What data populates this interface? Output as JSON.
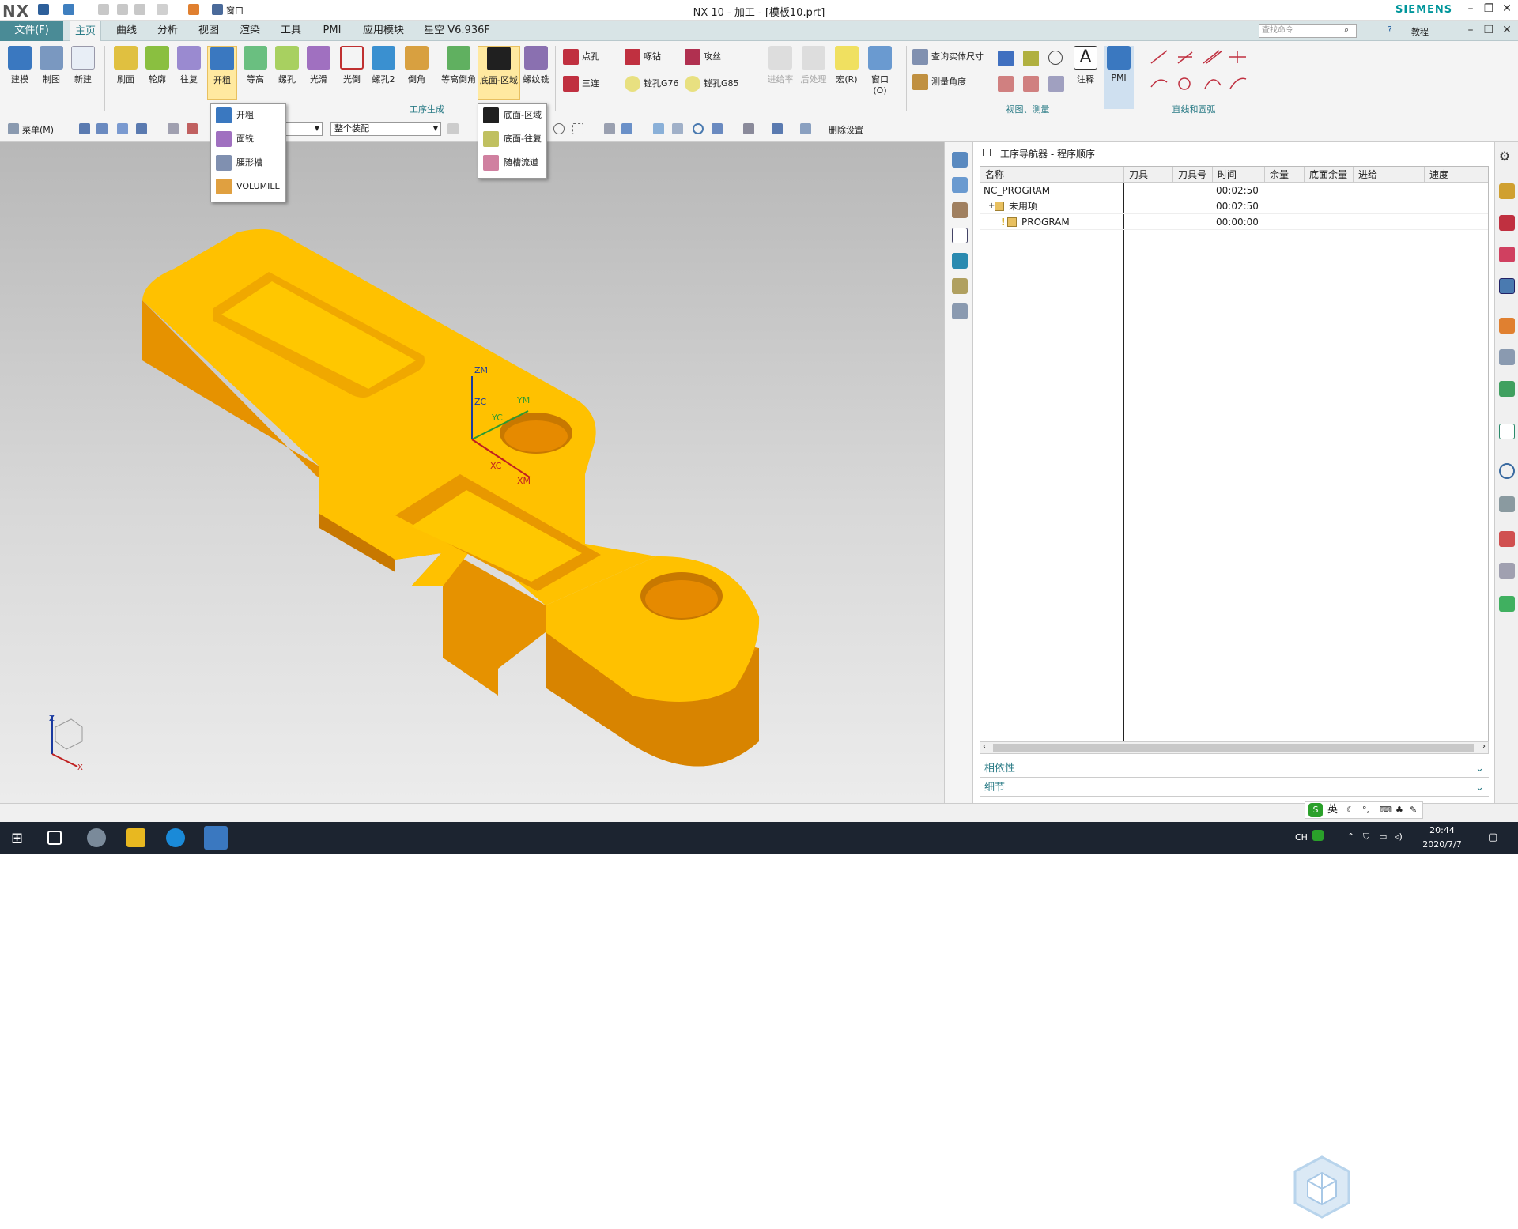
{
  "titlebar": {
    "app_logo": "NX",
    "title": "NX 10 - 加工 - [模板10.prt]",
    "window_menu": "窗口",
    "brand": "SIEMENS",
    "brand_color": "#00969b"
  },
  "menubar": {
    "file": "文件(F)",
    "tabs": [
      "主页",
      "曲线",
      "分析",
      "视图",
      "渲染",
      "工具",
      "PMI",
      "应用模块",
      "星空 V6.936F"
    ],
    "search_placeholder": "查找命令",
    "help_label": "教程"
  },
  "ribbon": {
    "left_buttons": [
      "建模",
      "制图",
      "新建"
    ],
    "ops_buttons": [
      "刷面",
      "轮廓",
      "往复",
      "开粗",
      "等高",
      "螺孔",
      "光滑",
      "光倒",
      "螺孔2",
      "倒角",
      "等高倒角",
      "底面-区域",
      "螺纹铣"
    ],
    "group_ops": "工序生成",
    "drill_items": [
      "点孔",
      "啄钻",
      "攻丝",
      "三连",
      "镗孔G76",
      "镗孔G85"
    ],
    "mid_buttons": [
      "进给率",
      "后处理",
      "宏(R)",
      "窗口(O)"
    ],
    "measure_items": [
      "查询实体尺寸",
      "测量角度"
    ],
    "annotation": "注释",
    "pmi": "PMI",
    "group_view": "视图、测量",
    "group_lines": "直线和圆弧"
  },
  "toolbar2": {
    "menu": "菜单(M)",
    "assembly_combo": "整个装配",
    "delete_settings": "删除设置"
  },
  "dropdowns": {
    "rough": [
      "开粗",
      "面铣",
      "腰形槽",
      "VOLUMILL"
    ],
    "floor": [
      "底面-区域",
      "底面-往复",
      "随槽流道"
    ]
  },
  "viewport": {
    "part_color": "#f5b800",
    "labels": {
      "zm": "ZM",
      "zc": "ZC",
      "yc": "YC",
      "ym": "YM",
      "xc": "XC",
      "xm": "XM"
    },
    "triad": {
      "z": "Z",
      "x": "X"
    }
  },
  "navigator": {
    "title": "工序导航器 - 程序顺序",
    "columns": [
      "名称",
      "刀具",
      "刀具号",
      "时间",
      "余量",
      "底面余量",
      "进给",
      "速度"
    ],
    "rows": [
      {
        "name": "NC_PROGRAM",
        "time": "00:02:50"
      },
      {
        "name": "未用项",
        "time": "00:02:50"
      },
      {
        "name": "PROGRAM",
        "time": "00:00:00"
      }
    ],
    "dependencies": "相依性",
    "details": "细节"
  },
  "ime": {
    "lang": "英"
  },
  "taskbar": {
    "tray_lang": "CH",
    "time": "20:44",
    "date": "2020/7/7"
  }
}
